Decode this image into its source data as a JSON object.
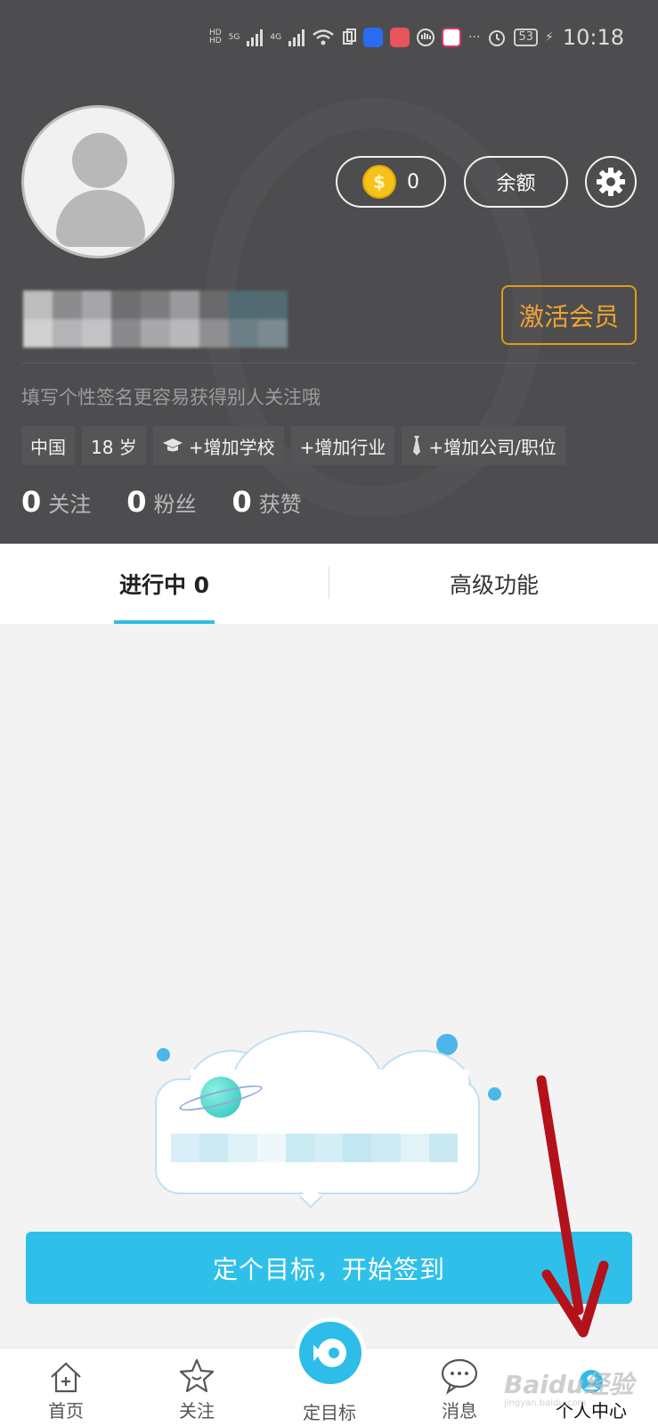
{
  "status_bar": {
    "time": "10:18",
    "battery": "53",
    "net_top": "HD",
    "net_bottom": "HD",
    "signal_labels": [
      "5G",
      "4G"
    ]
  },
  "header": {
    "coin_count": "0",
    "coin_symbol": "$",
    "balance_label": "余额",
    "vip_label": "激活会员",
    "signature_placeholder": "填写个性签名更容易获得别人关注哦",
    "tags": {
      "country": "中国",
      "age": "18 岁",
      "school": "+增加学校",
      "industry": "+增加行业",
      "company": "+增加公司/职位"
    },
    "stats": [
      {
        "value": "0",
        "label": "关注"
      },
      {
        "value": "0",
        "label": "粉丝"
      },
      {
        "value": "0",
        "label": "获赞"
      }
    ]
  },
  "tabs": {
    "active": "进行中 0",
    "advanced": "高级功能"
  },
  "cta_label": "定个目标，开始签到",
  "bottom_nav": {
    "home": "首页",
    "follow": "关注",
    "goal": "定目标",
    "messages": "消息",
    "profile": "个人中心"
  },
  "watermark": "Baidu经验",
  "watermark_sub": "jingyan.baidu.com",
  "colors": {
    "accent": "#2fc0ea",
    "vip": "#e39a1a",
    "header_bg": "#4d4d4f",
    "arrow": "#c1121c"
  }
}
